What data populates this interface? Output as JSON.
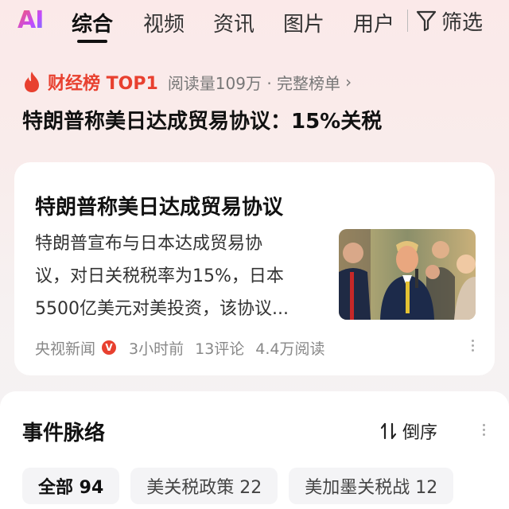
{
  "top_tabs": {
    "ai_logo": "AI",
    "items": [
      "综合",
      "视频",
      "资讯",
      "图片",
      "用户"
    ],
    "filter_label": "筛选"
  },
  "rank_banner": {
    "label": "财经榜 TOP1",
    "meta": "阅读量109万 · 完整榜单",
    "headline": "特朗普称美日达成贸易协议：15%关税"
  },
  "news_card": {
    "title": "特朗普称美日达成贸易协议",
    "summary_lines": [
      "特朗普宣布与日本达成贸易协",
      "议，对日关税税率为15%，日本",
      "5500亿美元对美投资，该协议..."
    ],
    "source": "央视新闻",
    "verified_badge": "V",
    "time": "3小时前",
    "comments": "13评论",
    "reads": "4.4万阅读"
  },
  "timeline": {
    "title": "事件脉络",
    "sort_label": "倒序",
    "chips": [
      "全部 94",
      "美关税政策 22",
      "美加墨关税战 12"
    ]
  },
  "colors": {
    "accent_red": "#e8402f",
    "text_primary": "#111111",
    "text_secondary": "#888888"
  }
}
